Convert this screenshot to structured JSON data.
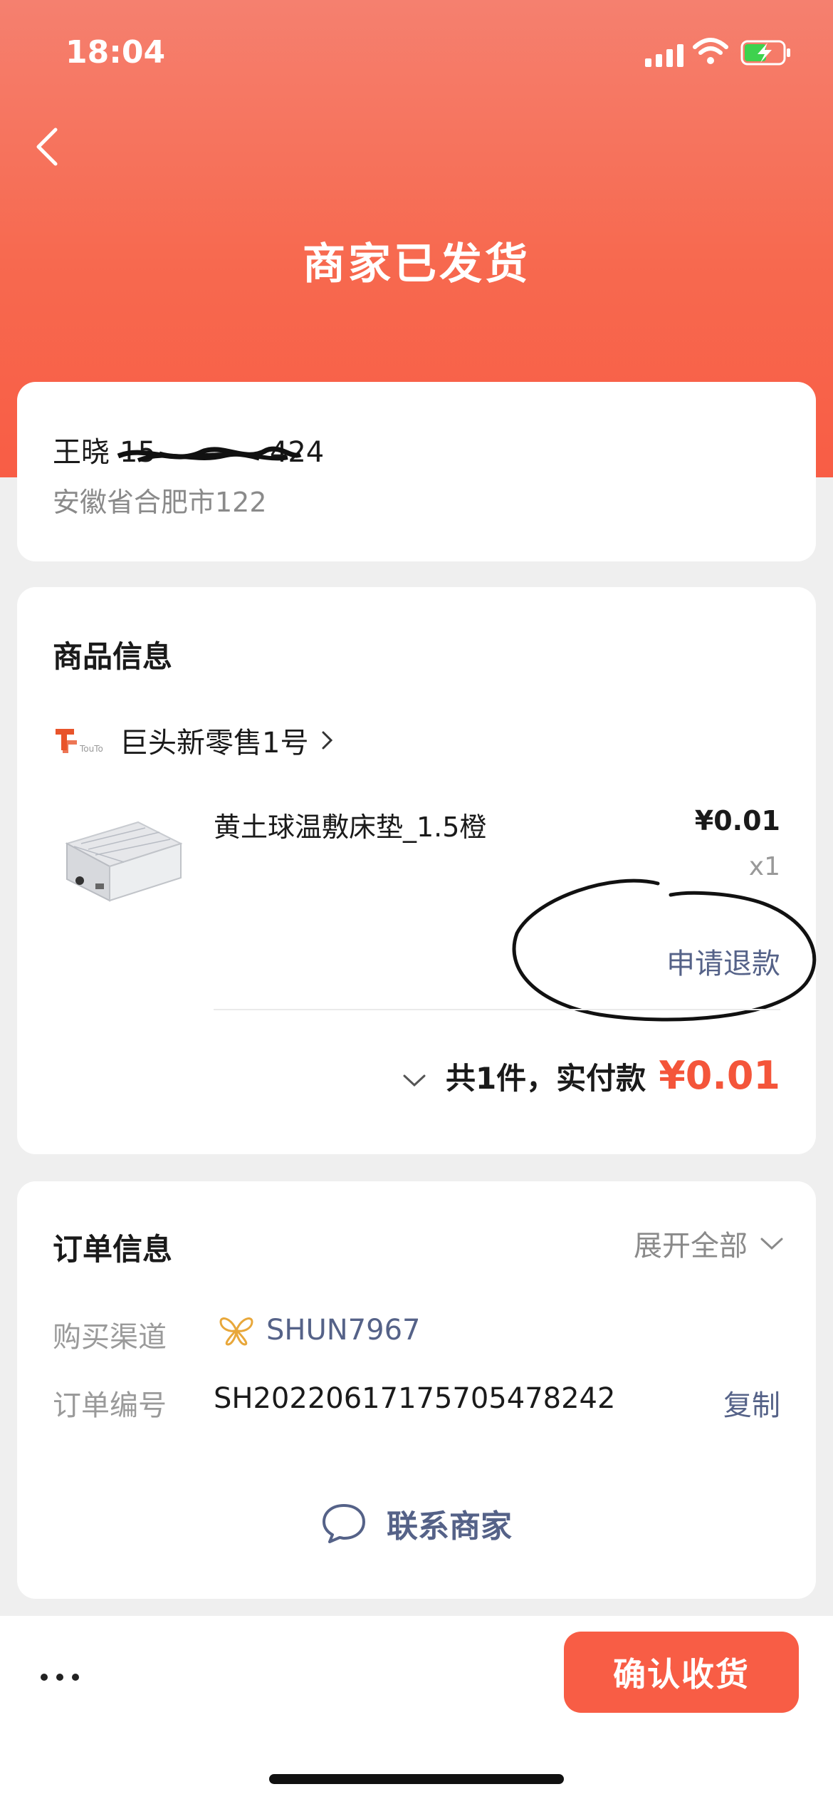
{
  "status_bar": {
    "time": "18:04",
    "icons": [
      "signal-icon",
      "wifi-icon",
      "battery-charging-icon"
    ]
  },
  "header": {
    "back_icon": "chevron-left-icon",
    "title": "商家已发货"
  },
  "address": {
    "name": "王晓",
    "phone_visible": "15",
    "phone_tail": "424",
    "location": "安徽省合肥市122"
  },
  "goods": {
    "section_title": "商品信息",
    "shop": {
      "logo": "tt-shop-logo",
      "name": "巨头新零售1号"
    },
    "product": {
      "name": "黄土球温敷床垫_1.5橙",
      "price": "¥0.01",
      "quantity": "x1",
      "refund_label": "申请退款"
    },
    "summary": {
      "text": "共1件，实付款",
      "amount": "¥0.01"
    }
  },
  "order": {
    "section_title": "订单信息",
    "expand_label": "展开全部",
    "channel_label": "购买渠道",
    "channel_name": "SHUN7967",
    "order_no_label": "订单编号",
    "order_no": "SH20220617175705478242",
    "copy_label": "复制",
    "contact_label": "联系商家"
  },
  "bottom": {
    "more_icon": "more-dots-icon",
    "confirm_label": "确认收货"
  },
  "colors": {
    "accent": "#f85d45",
    "link": "#556288",
    "muted": "#9a9a9a"
  }
}
